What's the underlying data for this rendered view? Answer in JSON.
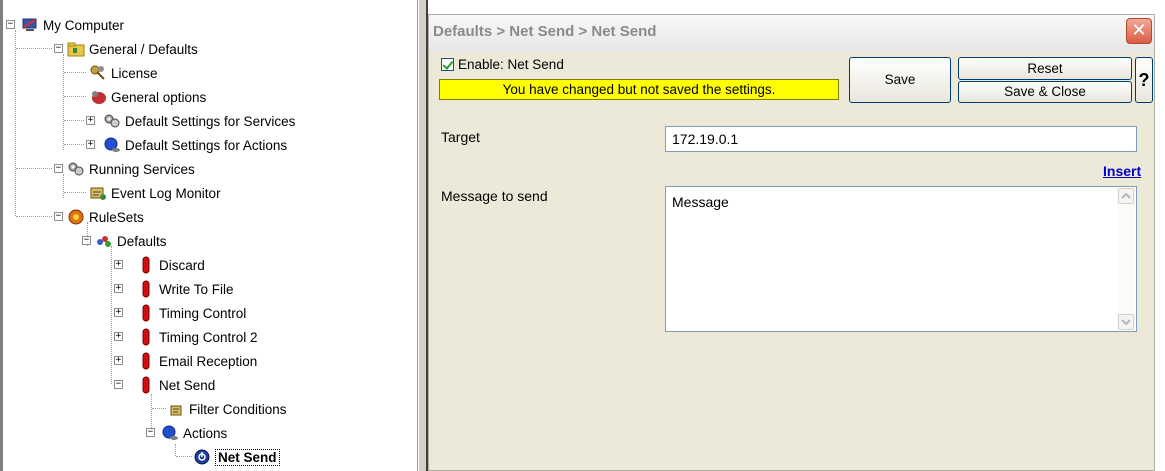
{
  "tree": {
    "items": [
      {
        "label": "My Computer",
        "icon": "computer-icon"
      },
      {
        "label": "General / Defaults",
        "icon": "folder-icon"
      },
      {
        "label": "License",
        "icon": "keys-icon"
      },
      {
        "label": "General options",
        "icon": "options-icon"
      },
      {
        "label": "Default Settings for Services",
        "icon": "gears-icon"
      },
      {
        "label": "Default Settings for Actions",
        "icon": "actions-icon"
      },
      {
        "label": "Running Services",
        "icon": "gears-icon"
      },
      {
        "label": "Event Log Monitor",
        "icon": "monitor-icon"
      },
      {
        "label": "RuleSets",
        "icon": "ruleset-icon"
      },
      {
        "label": "Defaults",
        "icon": "defaults-icon"
      },
      {
        "label": "Discard",
        "icon": "rule-icon"
      },
      {
        "label": "Write To File",
        "icon": "rule-icon"
      },
      {
        "label": "Timing Control",
        "icon": "rule-icon"
      },
      {
        "label": "Timing Control 2",
        "icon": "rule-icon"
      },
      {
        "label": "Email Reception",
        "icon": "rule-icon"
      },
      {
        "label": "Net Send",
        "icon": "rule-icon"
      },
      {
        "label": "Filter Conditions",
        "icon": "filter-icon"
      },
      {
        "label": "Actions",
        "icon": "actions-icon"
      },
      {
        "label": "Net Send",
        "icon": "netsend-icon"
      }
    ]
  },
  "settings": {
    "breadcrumb": "Defaults > Net Send > Net Send",
    "close_label": "✕",
    "enable_label": "Enable: Net Send",
    "enable_checked": true,
    "unsaved_notice": "You have changed but not saved the settings.",
    "save_label": "Save",
    "reset_label": "Reset",
    "save_close_label": "Save & Close",
    "help_label": "?",
    "target_label": "Target",
    "target_value": "172.19.0.1",
    "insert_label": "Insert",
    "message_label": "Message to send",
    "message_value": "Message"
  },
  "colors": {
    "banner": "#ffff00",
    "link": "#0000cc",
    "pane_bg": "#ece9d8",
    "close": "#d85d43"
  }
}
